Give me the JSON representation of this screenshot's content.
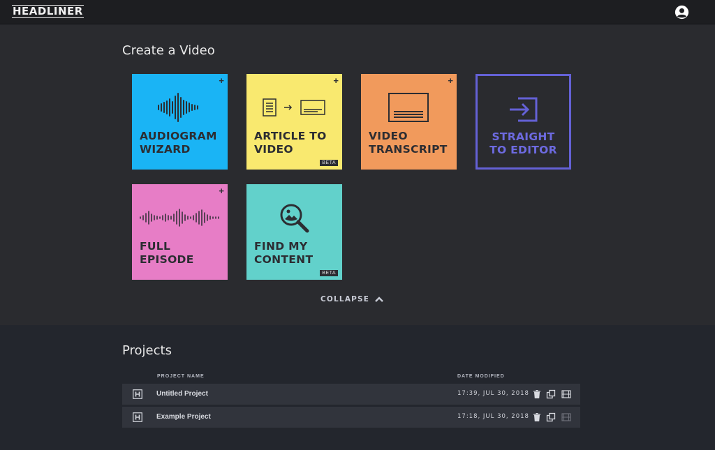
{
  "header": {
    "logo_text": "HEADLINER",
    "account_icon": "user-circle-icon"
  },
  "create": {
    "title": "Create a Video",
    "collapse_label": "COLLAPSE",
    "cards": [
      {
        "label": "AUDIOGRAM\nWIZARD",
        "color": "#1ab4f5",
        "icon": "waveform-icon"
      },
      {
        "label": "ARTICLE TO\nVIDEO",
        "color": "#f9e96f",
        "icon": "article-to-video-icon",
        "badge": "BETA"
      },
      {
        "label": "VIDEO\nTRANSCRIPT",
        "color": "#f19a5c",
        "icon": "transcript-screen-icon"
      },
      {
        "label": "STRAIGHT\nTO EDITOR",
        "color": "#6461d6",
        "icon": "enter-editor-icon"
      },
      {
        "label": "FULL\nEPISODE",
        "color": "#e77dc6",
        "icon": "long-waveform-icon"
      },
      {
        "label": "FIND MY\nCONTENT",
        "color": "#62d1cb",
        "icon": "search-image-icon",
        "badge": "BETA"
      }
    ]
  },
  "projects": {
    "title": "Projects",
    "columns": {
      "name": "PROJECT NAME",
      "date": "DATE MODIFIED"
    },
    "rows": [
      {
        "name": "Untitled Project",
        "date": "17:39, JUL 30, 2018"
      },
      {
        "name": "Example Project",
        "date": "17:18, JUL 30, 2018"
      }
    ]
  }
}
